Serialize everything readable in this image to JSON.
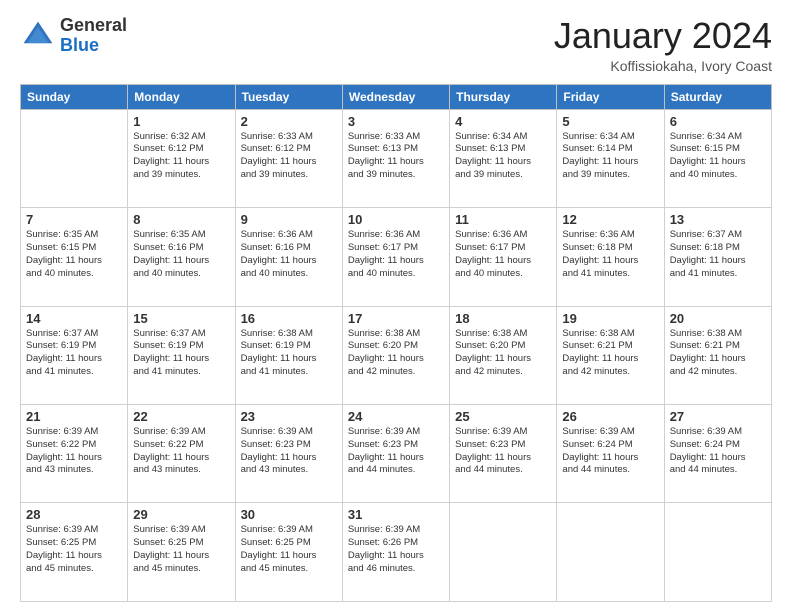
{
  "header": {
    "logo": {
      "general": "General",
      "blue": "Blue"
    },
    "title": "January 2024",
    "location": "Koffissiokaha, Ivory Coast"
  },
  "weekdays": [
    "Sunday",
    "Monday",
    "Tuesday",
    "Wednesday",
    "Thursday",
    "Friday",
    "Saturday"
  ],
  "weeks": [
    [
      {
        "day": "",
        "content": ""
      },
      {
        "day": "1",
        "content": "Sunrise: 6:32 AM\nSunset: 6:12 PM\nDaylight: 11 hours\nand 39 minutes."
      },
      {
        "day": "2",
        "content": "Sunrise: 6:33 AM\nSunset: 6:12 PM\nDaylight: 11 hours\nand 39 minutes."
      },
      {
        "day": "3",
        "content": "Sunrise: 6:33 AM\nSunset: 6:13 PM\nDaylight: 11 hours\nand 39 minutes."
      },
      {
        "day": "4",
        "content": "Sunrise: 6:34 AM\nSunset: 6:13 PM\nDaylight: 11 hours\nand 39 minutes."
      },
      {
        "day": "5",
        "content": "Sunrise: 6:34 AM\nSunset: 6:14 PM\nDaylight: 11 hours\nand 39 minutes."
      },
      {
        "day": "6",
        "content": "Sunrise: 6:34 AM\nSunset: 6:15 PM\nDaylight: 11 hours\nand 40 minutes."
      }
    ],
    [
      {
        "day": "7",
        "content": "Sunrise: 6:35 AM\nSunset: 6:15 PM\nDaylight: 11 hours\nand 40 minutes."
      },
      {
        "day": "8",
        "content": "Sunrise: 6:35 AM\nSunset: 6:16 PM\nDaylight: 11 hours\nand 40 minutes."
      },
      {
        "day": "9",
        "content": "Sunrise: 6:36 AM\nSunset: 6:16 PM\nDaylight: 11 hours\nand 40 minutes."
      },
      {
        "day": "10",
        "content": "Sunrise: 6:36 AM\nSunset: 6:17 PM\nDaylight: 11 hours\nand 40 minutes."
      },
      {
        "day": "11",
        "content": "Sunrise: 6:36 AM\nSunset: 6:17 PM\nDaylight: 11 hours\nand 40 minutes."
      },
      {
        "day": "12",
        "content": "Sunrise: 6:36 AM\nSunset: 6:18 PM\nDaylight: 11 hours\nand 41 minutes."
      },
      {
        "day": "13",
        "content": "Sunrise: 6:37 AM\nSunset: 6:18 PM\nDaylight: 11 hours\nand 41 minutes."
      }
    ],
    [
      {
        "day": "14",
        "content": "Sunrise: 6:37 AM\nSunset: 6:19 PM\nDaylight: 11 hours\nand 41 minutes."
      },
      {
        "day": "15",
        "content": "Sunrise: 6:37 AM\nSunset: 6:19 PM\nDaylight: 11 hours\nand 41 minutes."
      },
      {
        "day": "16",
        "content": "Sunrise: 6:38 AM\nSunset: 6:19 PM\nDaylight: 11 hours\nand 41 minutes."
      },
      {
        "day": "17",
        "content": "Sunrise: 6:38 AM\nSunset: 6:20 PM\nDaylight: 11 hours\nand 42 minutes."
      },
      {
        "day": "18",
        "content": "Sunrise: 6:38 AM\nSunset: 6:20 PM\nDaylight: 11 hours\nand 42 minutes."
      },
      {
        "day": "19",
        "content": "Sunrise: 6:38 AM\nSunset: 6:21 PM\nDaylight: 11 hours\nand 42 minutes."
      },
      {
        "day": "20",
        "content": "Sunrise: 6:38 AM\nSunset: 6:21 PM\nDaylight: 11 hours\nand 42 minutes."
      }
    ],
    [
      {
        "day": "21",
        "content": "Sunrise: 6:39 AM\nSunset: 6:22 PM\nDaylight: 11 hours\nand 43 minutes."
      },
      {
        "day": "22",
        "content": "Sunrise: 6:39 AM\nSunset: 6:22 PM\nDaylight: 11 hours\nand 43 minutes."
      },
      {
        "day": "23",
        "content": "Sunrise: 6:39 AM\nSunset: 6:23 PM\nDaylight: 11 hours\nand 43 minutes."
      },
      {
        "day": "24",
        "content": "Sunrise: 6:39 AM\nSunset: 6:23 PM\nDaylight: 11 hours\nand 44 minutes."
      },
      {
        "day": "25",
        "content": "Sunrise: 6:39 AM\nSunset: 6:23 PM\nDaylight: 11 hours\nand 44 minutes."
      },
      {
        "day": "26",
        "content": "Sunrise: 6:39 AM\nSunset: 6:24 PM\nDaylight: 11 hours\nand 44 minutes."
      },
      {
        "day": "27",
        "content": "Sunrise: 6:39 AM\nSunset: 6:24 PM\nDaylight: 11 hours\nand 44 minutes."
      }
    ],
    [
      {
        "day": "28",
        "content": "Sunrise: 6:39 AM\nSunset: 6:25 PM\nDaylight: 11 hours\nand 45 minutes."
      },
      {
        "day": "29",
        "content": "Sunrise: 6:39 AM\nSunset: 6:25 PM\nDaylight: 11 hours\nand 45 minutes."
      },
      {
        "day": "30",
        "content": "Sunrise: 6:39 AM\nSunset: 6:25 PM\nDaylight: 11 hours\nand 45 minutes."
      },
      {
        "day": "31",
        "content": "Sunrise: 6:39 AM\nSunset: 6:26 PM\nDaylight: 11 hours\nand 46 minutes."
      },
      {
        "day": "",
        "content": ""
      },
      {
        "day": "",
        "content": ""
      },
      {
        "day": "",
        "content": ""
      }
    ]
  ]
}
